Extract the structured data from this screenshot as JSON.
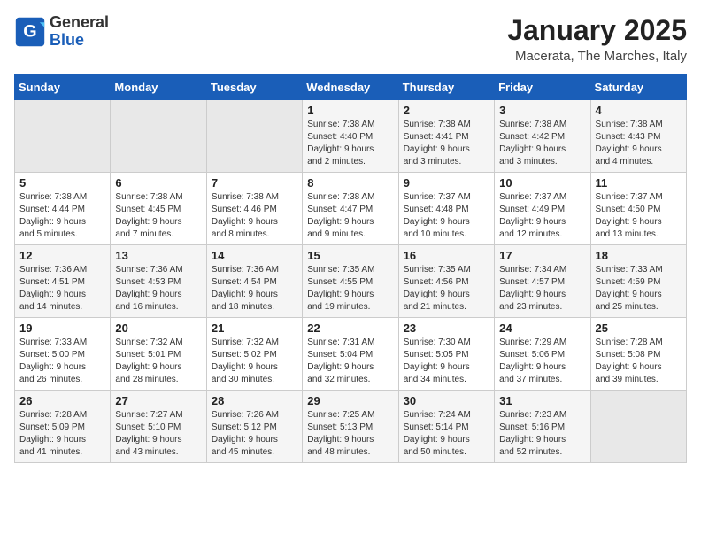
{
  "logo": {
    "general": "General",
    "blue": "Blue"
  },
  "header": {
    "month": "January 2025",
    "location": "Macerata, The Marches, Italy"
  },
  "weekdays": [
    "Sunday",
    "Monday",
    "Tuesday",
    "Wednesday",
    "Thursday",
    "Friday",
    "Saturday"
  ],
  "weeks": [
    [
      {
        "day": "",
        "info": ""
      },
      {
        "day": "",
        "info": ""
      },
      {
        "day": "",
        "info": ""
      },
      {
        "day": "1",
        "info": "Sunrise: 7:38 AM\nSunset: 4:40 PM\nDaylight: 9 hours\nand 2 minutes."
      },
      {
        "day": "2",
        "info": "Sunrise: 7:38 AM\nSunset: 4:41 PM\nDaylight: 9 hours\nand 3 minutes."
      },
      {
        "day": "3",
        "info": "Sunrise: 7:38 AM\nSunset: 4:42 PM\nDaylight: 9 hours\nand 3 minutes."
      },
      {
        "day": "4",
        "info": "Sunrise: 7:38 AM\nSunset: 4:43 PM\nDaylight: 9 hours\nand 4 minutes."
      }
    ],
    [
      {
        "day": "5",
        "info": "Sunrise: 7:38 AM\nSunset: 4:44 PM\nDaylight: 9 hours\nand 5 minutes."
      },
      {
        "day": "6",
        "info": "Sunrise: 7:38 AM\nSunset: 4:45 PM\nDaylight: 9 hours\nand 7 minutes."
      },
      {
        "day": "7",
        "info": "Sunrise: 7:38 AM\nSunset: 4:46 PM\nDaylight: 9 hours\nand 8 minutes."
      },
      {
        "day": "8",
        "info": "Sunrise: 7:38 AM\nSunset: 4:47 PM\nDaylight: 9 hours\nand 9 minutes."
      },
      {
        "day": "9",
        "info": "Sunrise: 7:37 AM\nSunset: 4:48 PM\nDaylight: 9 hours\nand 10 minutes."
      },
      {
        "day": "10",
        "info": "Sunrise: 7:37 AM\nSunset: 4:49 PM\nDaylight: 9 hours\nand 12 minutes."
      },
      {
        "day": "11",
        "info": "Sunrise: 7:37 AM\nSunset: 4:50 PM\nDaylight: 9 hours\nand 13 minutes."
      }
    ],
    [
      {
        "day": "12",
        "info": "Sunrise: 7:36 AM\nSunset: 4:51 PM\nDaylight: 9 hours\nand 14 minutes."
      },
      {
        "day": "13",
        "info": "Sunrise: 7:36 AM\nSunset: 4:53 PM\nDaylight: 9 hours\nand 16 minutes."
      },
      {
        "day": "14",
        "info": "Sunrise: 7:36 AM\nSunset: 4:54 PM\nDaylight: 9 hours\nand 18 minutes."
      },
      {
        "day": "15",
        "info": "Sunrise: 7:35 AM\nSunset: 4:55 PM\nDaylight: 9 hours\nand 19 minutes."
      },
      {
        "day": "16",
        "info": "Sunrise: 7:35 AM\nSunset: 4:56 PM\nDaylight: 9 hours\nand 21 minutes."
      },
      {
        "day": "17",
        "info": "Sunrise: 7:34 AM\nSunset: 4:57 PM\nDaylight: 9 hours\nand 23 minutes."
      },
      {
        "day": "18",
        "info": "Sunrise: 7:33 AM\nSunset: 4:59 PM\nDaylight: 9 hours\nand 25 minutes."
      }
    ],
    [
      {
        "day": "19",
        "info": "Sunrise: 7:33 AM\nSunset: 5:00 PM\nDaylight: 9 hours\nand 26 minutes."
      },
      {
        "day": "20",
        "info": "Sunrise: 7:32 AM\nSunset: 5:01 PM\nDaylight: 9 hours\nand 28 minutes."
      },
      {
        "day": "21",
        "info": "Sunrise: 7:32 AM\nSunset: 5:02 PM\nDaylight: 9 hours\nand 30 minutes."
      },
      {
        "day": "22",
        "info": "Sunrise: 7:31 AM\nSunset: 5:04 PM\nDaylight: 9 hours\nand 32 minutes."
      },
      {
        "day": "23",
        "info": "Sunrise: 7:30 AM\nSunset: 5:05 PM\nDaylight: 9 hours\nand 34 minutes."
      },
      {
        "day": "24",
        "info": "Sunrise: 7:29 AM\nSunset: 5:06 PM\nDaylight: 9 hours\nand 37 minutes."
      },
      {
        "day": "25",
        "info": "Sunrise: 7:28 AM\nSunset: 5:08 PM\nDaylight: 9 hours\nand 39 minutes."
      }
    ],
    [
      {
        "day": "26",
        "info": "Sunrise: 7:28 AM\nSunset: 5:09 PM\nDaylight: 9 hours\nand 41 minutes."
      },
      {
        "day": "27",
        "info": "Sunrise: 7:27 AM\nSunset: 5:10 PM\nDaylight: 9 hours\nand 43 minutes."
      },
      {
        "day": "28",
        "info": "Sunrise: 7:26 AM\nSunset: 5:12 PM\nDaylight: 9 hours\nand 45 minutes."
      },
      {
        "day": "29",
        "info": "Sunrise: 7:25 AM\nSunset: 5:13 PM\nDaylight: 9 hours\nand 48 minutes."
      },
      {
        "day": "30",
        "info": "Sunrise: 7:24 AM\nSunset: 5:14 PM\nDaylight: 9 hours\nand 50 minutes."
      },
      {
        "day": "31",
        "info": "Sunrise: 7:23 AM\nSunset: 5:16 PM\nDaylight: 9 hours\nand 52 minutes."
      },
      {
        "day": "",
        "info": ""
      }
    ]
  ]
}
